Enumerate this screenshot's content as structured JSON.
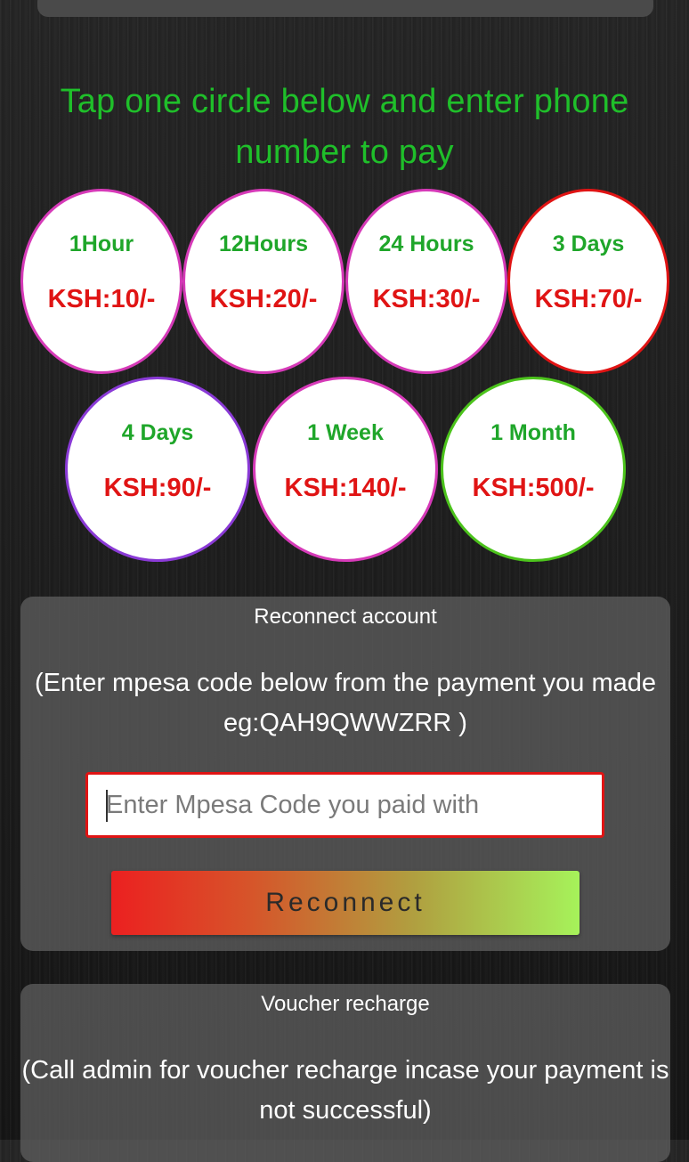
{
  "headline": "Tap one circle below and enter phone number to pay",
  "plans": [
    {
      "duration": "1Hour",
      "price": "KSH:10/-",
      "border_color": "#d63ab8"
    },
    {
      "duration": "12Hours",
      "price": "KSH:20/-",
      "border_color": "#d63ab8"
    },
    {
      "duration": "24 Hours",
      "price": "KSH:30/-",
      "border_color": "#d63ab8"
    },
    {
      "duration": "3 Days",
      "price": "KSH:70/-",
      "border_color": "#e01414"
    },
    {
      "duration": "4 Days",
      "price": "KSH:90/-",
      "border_color": "#8a3ad6"
    },
    {
      "duration": "1 Week",
      "price": "KSH:140/-",
      "border_color": "#d63ab8"
    },
    {
      "duration": "1 Month",
      "price": "KSH:500/-",
      "border_color": "#4cc31c"
    }
  ],
  "reconnect": {
    "title": "Reconnect account",
    "note": "(Enter mpesa code below from the payment you made eg:QAH9QWWZRR )",
    "input_placeholder": "Enter Mpesa Code you paid with",
    "input_value": "",
    "button_label": "Reconnect"
  },
  "voucher": {
    "title": "Voucher recharge",
    "note": "(Call admin for voucher recharge incase your payment is not successful)"
  },
  "colors": {
    "headline_green": "#1fbf2a",
    "price_red": "#e01414",
    "duration_green": "#1fa62a"
  }
}
